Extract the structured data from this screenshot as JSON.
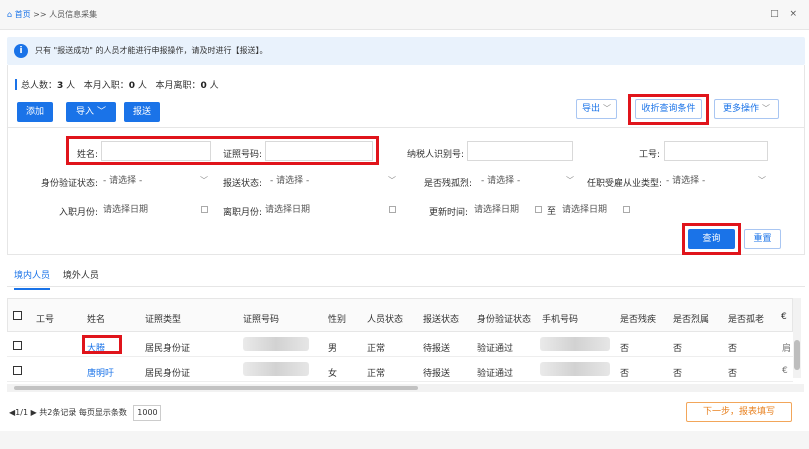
{
  "breadcrumb": {
    "home": "首页",
    "sep": " >> ",
    "current": "人员信息采集"
  },
  "window_controls": "□ ×",
  "notice": {
    "icon": "i",
    "text": "只有 \"报送成功\" 的人员才能进行申报操作，请及时进行【报送】。"
  },
  "summary": {
    "total_label": "总人数：",
    "total": "3",
    "total_unit": " 人",
    "in_label": "本月入职：",
    "in": "0",
    "in_unit": " 人",
    "out_label": "本月离职：",
    "out": "0",
    "out_unit": " 人"
  },
  "toolbar": {
    "add": "添加",
    "import": "导入",
    "submit": "报送",
    "export": "导出",
    "collapse": "收折查询条件",
    "more": "更多操作"
  },
  "filters": {
    "name": "姓名:",
    "id_no": "证照号码:",
    "tax_id": "纳税人识别号:",
    "job_no": "工号:",
    "id_verify": "身份验证状态:",
    "submit_status": "报送状态:",
    "is_disabled": "是否残孤烈:",
    "employment_type": "任职受雇从业类型:",
    "select_placeholder": "- 请选择 -",
    "entry_month": "入职月份:",
    "leave_month": "离职月份:",
    "update_time": "更新时间:",
    "date_placeholder": "请选择日期",
    "to": "至",
    "query": "查询",
    "reset": "重置"
  },
  "tabs": [
    "境内人员",
    "境外人员"
  ],
  "table": {
    "headers": [
      "工号",
      "姓名",
      "证照类型",
      "证照号码",
      "性别",
      "人员状态",
      "报送状态",
      "身份验证状态",
      "手机号码",
      "是否残疾",
      "是否烈属",
      "是否孤老",
      "€"
    ],
    "rows": [
      {
        "name": "大腾",
        "id_type": "居民身份证",
        "gender": "男",
        "status": "正常",
        "submit": "待报送",
        "verify": "验证通过",
        "disabled": "否",
        "martyr": "否",
        "orphan": "否",
        "extra": "肩"
      },
      {
        "name": "唐明吁",
        "id_type": "居民身份证",
        "gender": "女",
        "status": "正常",
        "submit": "待报送",
        "verify": "验证通过",
        "disabled": "否",
        "martyr": "否",
        "orphan": "否",
        "extra": "€"
      }
    ]
  },
  "pager": {
    "text": "◀1/1 ▶ 共2条记录  每页显示条数",
    "size": "1000"
  },
  "next_button": "下一步，报表填写",
  "colors": {
    "accent": "#1a73e8",
    "highlight": "#e0141b",
    "next": "#e8801e"
  }
}
